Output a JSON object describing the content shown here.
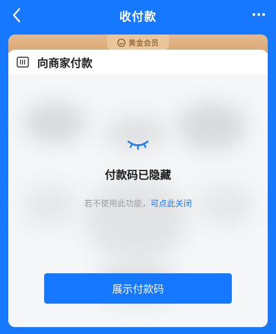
{
  "header": {
    "title": "收付款",
    "back_icon": "chevron-left-icon",
    "more_icon": "more-dots-icon"
  },
  "membership": {
    "label": "黄金会员",
    "icon": "smile-badge-icon",
    "color": "#d9aa79"
  },
  "merchant": {
    "label": "向商家付款",
    "icon": "barcode-icon"
  },
  "hidden_state": {
    "icon": "closed-eye-icon",
    "title": "付款码已隐藏",
    "hint_prefix": "若不使用此功能，",
    "hint_link": "可点此关闭"
  },
  "primary_button": {
    "label": "展示付款码"
  },
  "colors": {
    "brand": "#1677ff",
    "gold": "#d9aa79",
    "hint": "#9a9a9a"
  }
}
